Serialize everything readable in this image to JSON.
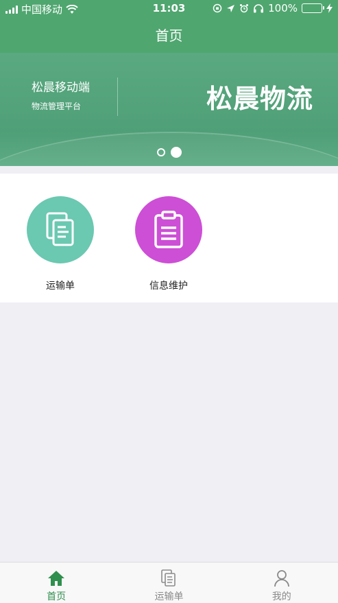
{
  "status_bar": {
    "carrier": "中国移动",
    "time": "11:03",
    "battery": "100%",
    "battery_level": 1.0
  },
  "nav": {
    "title": "首页"
  },
  "banner": {
    "subtitle": "松晨移动端",
    "caption": "物流管理平台",
    "brand": "松晨物流",
    "page_count": 2,
    "active_page": 2
  },
  "actions": [
    {
      "label": "运输单",
      "icon": "documents-icon",
      "color": "#6bc8b1"
    },
    {
      "label": "信息维护",
      "icon": "clipboard-icon",
      "color": "#cd4fd6"
    }
  ],
  "tabbar": {
    "items": [
      {
        "label": "首页",
        "icon": "home-icon",
        "active": true
      },
      {
        "label": "运输单",
        "icon": "document-icon",
        "active": false
      },
      {
        "label": "我的",
        "icon": "user-icon",
        "active": false
      }
    ]
  },
  "colors": {
    "primary": "#4fa66f",
    "active_tab": "#2f8f4e",
    "inactive_tab": "#8a8a8a"
  }
}
